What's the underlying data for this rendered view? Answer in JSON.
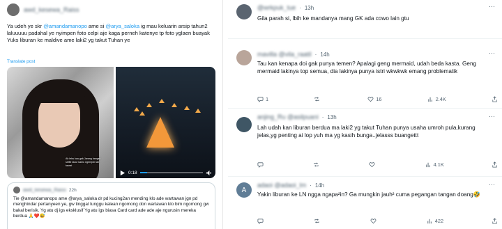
{
  "post": {
    "author": "awd_kesewa_Raiss",
    "body_parts": [
      "Ya udeh ye skr ",
      "@amandamanopo",
      " ame si ",
      "@arya_saloka",
      " ig mau keluarin arsip tahun2 laluuuuu padahal ye nyimpen foto celpi aje kaga perneh katenye tp foto yglaen buayak",
      "Yuks liburan ke maldive ame laki2 yg takut Tuhan ye"
    ],
    "translate": "Translate post",
    "photo_caption": "Ah lebu kau gak Jarang banget selfie dulur kamu ngerepin lah taurat",
    "video_time": "0:18",
    "video_progress": 0.12
  },
  "quote": {
    "author": "awd_kesewa_Raiss",
    "time": "22h",
    "text": "Tie @amandamanopo ame @arya_saloka dr pd kucing2an mending klo ade wartawan jgn pd menghindar pertanyeen ye, gw tinggal tunggu kalean ngomong don wartawan klo bim ngomong gw bakal berisik. Yg atu dj igs eksklusif Yg atu igs biasa Card card ade ade aje ngurusin mereka berdua 🙏❤️😅"
  },
  "replies": [
    {
      "handle": "@wrkpuk_tue",
      "time": "13h",
      "text": "Gila parah si, lbih ke mandanya mang GK ada cowo lain gtu",
      "comments": "",
      "reposts": "",
      "likes": "",
      "views": "",
      "avatar_color": "#5a6470"
    },
    {
      "handle": "mavilla @vila_raatil",
      "time": "14h",
      "text": "Tau kan kenapa doi gak punya temen? Apalagi geng mermaid, udah beda kasta. Geng mermaid lakinya top semua, dia lakinya punya istri wkwkwk emang problematik",
      "comments": "1",
      "reposts": "",
      "likes": "16",
      "views": "2.4K",
      "avatar_color": "#b9a59a"
    },
    {
      "handle": "anjing_Ru @asilpuani",
      "time": "13h",
      "text": "Lah udah kan liburan berdua ma laki2 yg takut Tuhan punya usaha umroh pula,kurang jelas,yg penting ai lop yuh ma yg kasih bunga..jelasss buangettt",
      "comments": "",
      "reposts": "",
      "likes": "",
      "views": "4.1K",
      "avatar_color": "#3f5665"
    },
    {
      "handle": "adaoi @adaoi_lm",
      "time": "14h",
      "text": "Yakin liburan ke LN ngga ngapa²in? Ga mungkin jauh² cuma pegangan tangan doang🤣",
      "comments": "",
      "reposts": "",
      "likes": "",
      "views": "422",
      "avatar_letter": "A",
      "avatar_color": "#607d96"
    }
  ],
  "icons": [
    "more-icon",
    "reply-icon",
    "repost-icon",
    "like-icon",
    "views-icon",
    "bookmark-icon",
    "share-icon"
  ]
}
